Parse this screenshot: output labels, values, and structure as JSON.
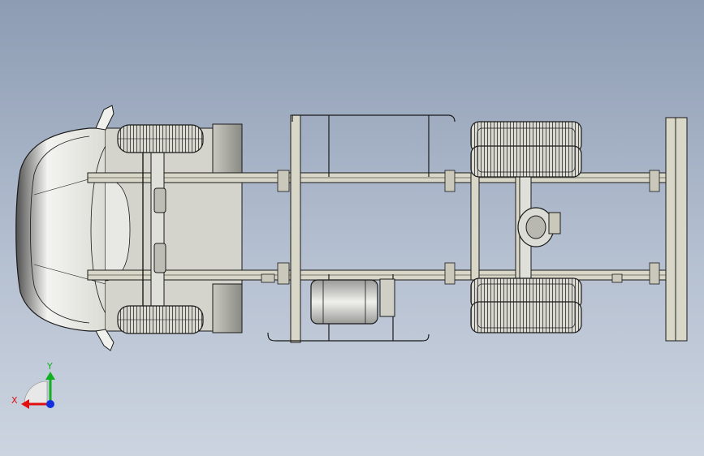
{
  "triad": {
    "x_label": "X",
    "y_label": "Y",
    "x_color": "#e01010",
    "y_color": "#10b020",
    "z_color": "#1030e0"
  },
  "colors": {
    "background_top": "#8d9cb3",
    "background_bottom": "#ccd4e0",
    "frame_fill": "#d8d7c8",
    "line": "#1a1a1a",
    "tire": "#2a2a2a",
    "cab": "#ebebe8"
  }
}
